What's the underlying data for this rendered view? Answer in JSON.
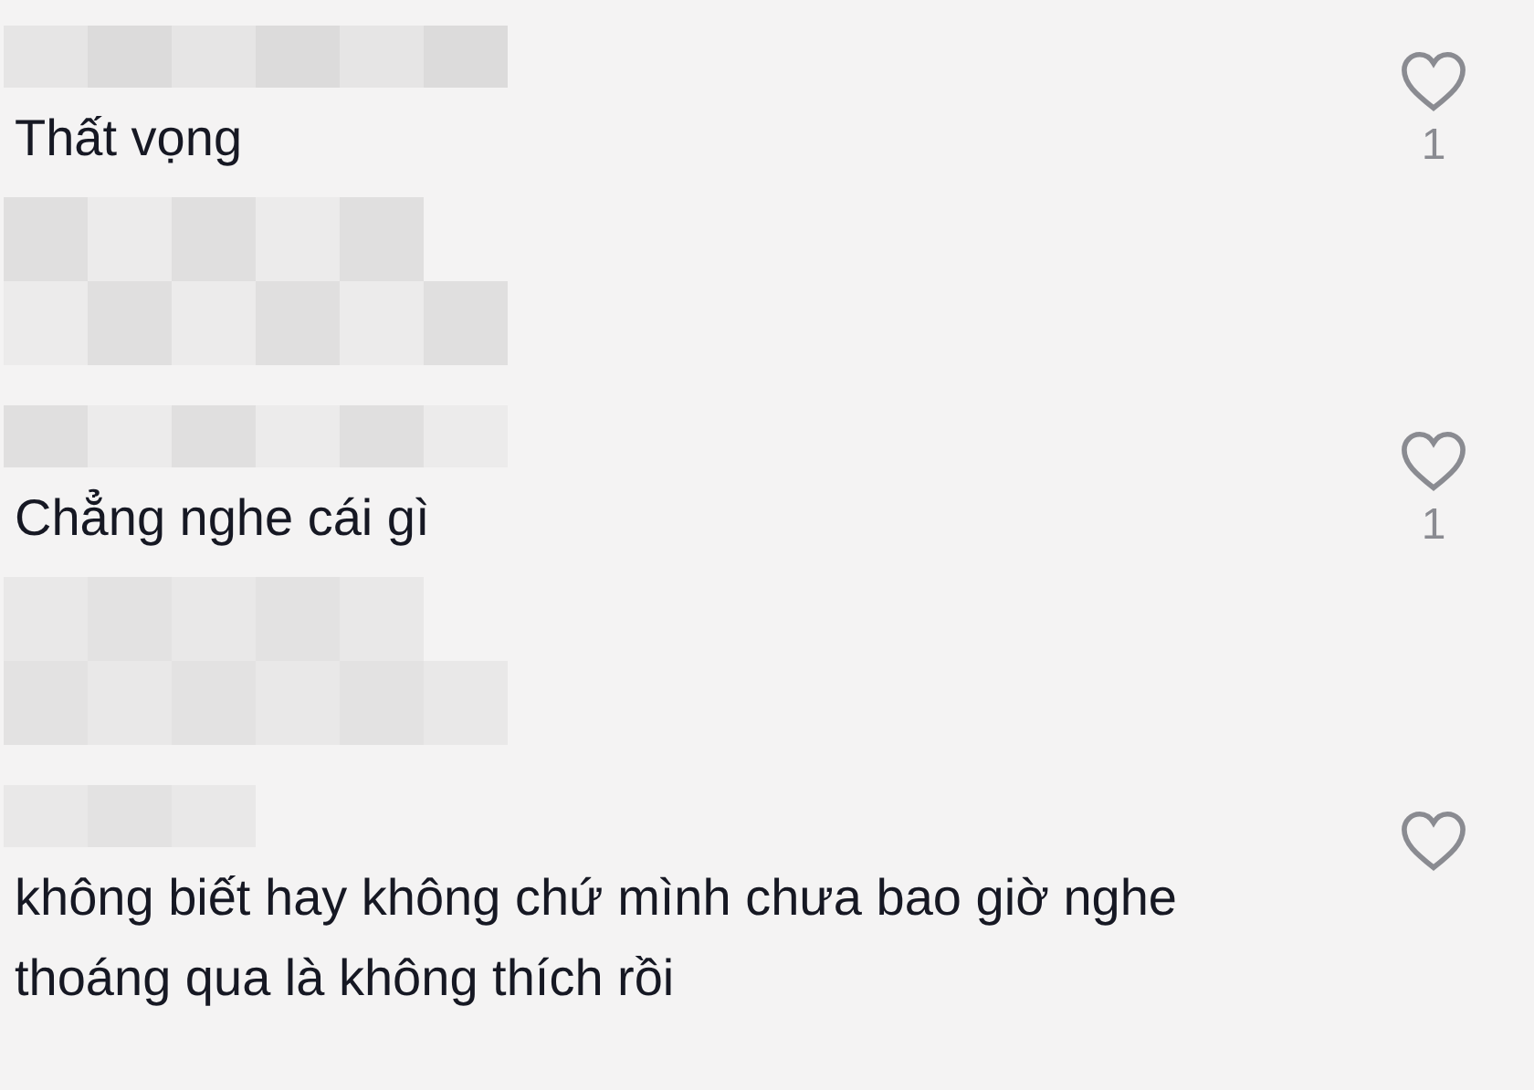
{
  "comments": [
    {
      "text": "Thất vọng",
      "likes": "1",
      "liked": false
    },
    {
      "text": "Chẳng nghe cái gì",
      "likes": "1",
      "liked": false
    },
    {
      "text": "không biết hay không chứ mình chưa bao giờ nghe thoáng qua là không thích rồi",
      "liked": false
    }
  ]
}
